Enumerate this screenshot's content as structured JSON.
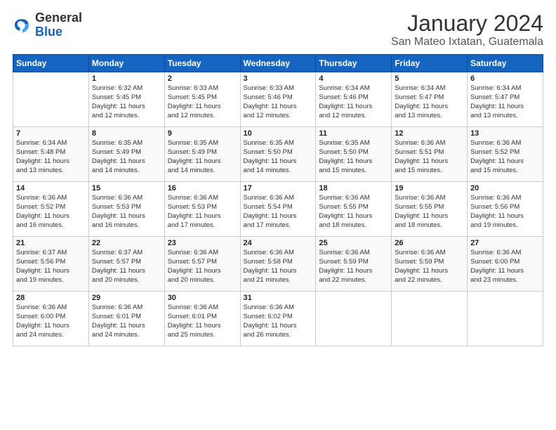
{
  "logo": {
    "general": "General",
    "blue": "Blue"
  },
  "title": "January 2024",
  "subtitle": "San Mateo Ixtatan, Guatemala",
  "days_of_week": [
    "Sunday",
    "Monday",
    "Tuesday",
    "Wednesday",
    "Thursday",
    "Friday",
    "Saturday"
  ],
  "weeks": [
    [
      {
        "day": "",
        "sunrise": "",
        "sunset": "",
        "daylight": "",
        "extra": ""
      },
      {
        "day": "1",
        "sunrise": "Sunrise: 6:32 AM",
        "sunset": "Sunset: 5:45 PM",
        "daylight": "Daylight: 11 hours",
        "extra": "and 12 minutes."
      },
      {
        "day": "2",
        "sunrise": "Sunrise: 6:33 AM",
        "sunset": "Sunset: 5:45 PM",
        "daylight": "Daylight: 11 hours",
        "extra": "and 12 minutes."
      },
      {
        "day": "3",
        "sunrise": "Sunrise: 6:33 AM",
        "sunset": "Sunset: 5:46 PM",
        "daylight": "Daylight: 11 hours",
        "extra": "and 12 minutes."
      },
      {
        "day": "4",
        "sunrise": "Sunrise: 6:34 AM",
        "sunset": "Sunset: 5:46 PM",
        "daylight": "Daylight: 11 hours",
        "extra": "and 12 minutes."
      },
      {
        "day": "5",
        "sunrise": "Sunrise: 6:34 AM",
        "sunset": "Sunset: 5:47 PM",
        "daylight": "Daylight: 11 hours",
        "extra": "and 13 minutes."
      },
      {
        "day": "6",
        "sunrise": "Sunrise: 6:34 AM",
        "sunset": "Sunset: 5:47 PM",
        "daylight": "Daylight: 11 hours",
        "extra": "and 13 minutes."
      }
    ],
    [
      {
        "day": "7",
        "sunrise": "Sunrise: 6:34 AM",
        "sunset": "Sunset: 5:48 PM",
        "daylight": "Daylight: 11 hours",
        "extra": "and 13 minutes."
      },
      {
        "day": "8",
        "sunrise": "Sunrise: 6:35 AM",
        "sunset": "Sunset: 5:49 PM",
        "daylight": "Daylight: 11 hours",
        "extra": "and 14 minutes."
      },
      {
        "day": "9",
        "sunrise": "Sunrise: 6:35 AM",
        "sunset": "Sunset: 5:49 PM",
        "daylight": "Daylight: 11 hours",
        "extra": "and 14 minutes."
      },
      {
        "day": "10",
        "sunrise": "Sunrise: 6:35 AM",
        "sunset": "Sunset: 5:50 PM",
        "daylight": "Daylight: 11 hours",
        "extra": "and 14 minutes."
      },
      {
        "day": "11",
        "sunrise": "Sunrise: 6:35 AM",
        "sunset": "Sunset: 5:50 PM",
        "daylight": "Daylight: 11 hours",
        "extra": "and 15 minutes."
      },
      {
        "day": "12",
        "sunrise": "Sunrise: 6:36 AM",
        "sunset": "Sunset: 5:51 PM",
        "daylight": "Daylight: 11 hours",
        "extra": "and 15 minutes."
      },
      {
        "day": "13",
        "sunrise": "Sunrise: 6:36 AM",
        "sunset": "Sunset: 5:52 PM",
        "daylight": "Daylight: 11 hours",
        "extra": "and 15 minutes."
      }
    ],
    [
      {
        "day": "14",
        "sunrise": "Sunrise: 6:36 AM",
        "sunset": "Sunset: 5:52 PM",
        "daylight": "Daylight: 11 hours",
        "extra": "and 16 minutes."
      },
      {
        "day": "15",
        "sunrise": "Sunrise: 6:36 AM",
        "sunset": "Sunset: 5:53 PM",
        "daylight": "Daylight: 11 hours",
        "extra": "and 16 minutes."
      },
      {
        "day": "16",
        "sunrise": "Sunrise: 6:36 AM",
        "sunset": "Sunset: 5:53 PM",
        "daylight": "Daylight: 11 hours",
        "extra": "and 17 minutes."
      },
      {
        "day": "17",
        "sunrise": "Sunrise: 6:36 AM",
        "sunset": "Sunset: 5:54 PM",
        "daylight": "Daylight: 11 hours",
        "extra": "and 17 minutes."
      },
      {
        "day": "18",
        "sunrise": "Sunrise: 6:36 AM",
        "sunset": "Sunset: 5:55 PM",
        "daylight": "Daylight: 11 hours",
        "extra": "and 18 minutes."
      },
      {
        "day": "19",
        "sunrise": "Sunrise: 6:36 AM",
        "sunset": "Sunset: 5:55 PM",
        "daylight": "Daylight: 11 hours",
        "extra": "and 18 minutes."
      },
      {
        "day": "20",
        "sunrise": "Sunrise: 6:36 AM",
        "sunset": "Sunset: 5:56 PM",
        "daylight": "Daylight: 11 hours",
        "extra": "and 19 minutes."
      }
    ],
    [
      {
        "day": "21",
        "sunrise": "Sunrise: 6:37 AM",
        "sunset": "Sunset: 5:56 PM",
        "daylight": "Daylight: 11 hours",
        "extra": "and 19 minutes."
      },
      {
        "day": "22",
        "sunrise": "Sunrise: 6:37 AM",
        "sunset": "Sunset: 5:57 PM",
        "daylight": "Daylight: 11 hours",
        "extra": "and 20 minutes."
      },
      {
        "day": "23",
        "sunrise": "Sunrise: 6:36 AM",
        "sunset": "Sunset: 5:57 PM",
        "daylight": "Daylight: 11 hours",
        "extra": "and 20 minutes."
      },
      {
        "day": "24",
        "sunrise": "Sunrise: 6:36 AM",
        "sunset": "Sunset: 5:58 PM",
        "daylight": "Daylight: 11 hours",
        "extra": "and 21 minutes."
      },
      {
        "day": "25",
        "sunrise": "Sunrise: 6:36 AM",
        "sunset": "Sunset: 5:59 PM",
        "daylight": "Daylight: 11 hours",
        "extra": "and 22 minutes."
      },
      {
        "day": "26",
        "sunrise": "Sunrise: 6:36 AM",
        "sunset": "Sunset: 5:59 PM",
        "daylight": "Daylight: 11 hours",
        "extra": "and 22 minutes."
      },
      {
        "day": "27",
        "sunrise": "Sunrise: 6:36 AM",
        "sunset": "Sunset: 6:00 PM",
        "daylight": "Daylight: 11 hours",
        "extra": "and 23 minutes."
      }
    ],
    [
      {
        "day": "28",
        "sunrise": "Sunrise: 6:36 AM",
        "sunset": "Sunset: 6:00 PM",
        "daylight": "Daylight: 11 hours",
        "extra": "and 24 minutes."
      },
      {
        "day": "29",
        "sunrise": "Sunrise: 6:36 AM",
        "sunset": "Sunset: 6:01 PM",
        "daylight": "Daylight: 11 hours",
        "extra": "and 24 minutes."
      },
      {
        "day": "30",
        "sunrise": "Sunrise: 6:36 AM",
        "sunset": "Sunset: 6:01 PM",
        "daylight": "Daylight: 11 hours",
        "extra": "and 25 minutes."
      },
      {
        "day": "31",
        "sunrise": "Sunrise: 6:36 AM",
        "sunset": "Sunset: 6:02 PM",
        "daylight": "Daylight: 11 hours",
        "extra": "and 26 minutes."
      },
      {
        "day": "",
        "sunrise": "",
        "sunset": "",
        "daylight": "",
        "extra": ""
      },
      {
        "day": "",
        "sunrise": "",
        "sunset": "",
        "daylight": "",
        "extra": ""
      },
      {
        "day": "",
        "sunrise": "",
        "sunset": "",
        "daylight": "",
        "extra": ""
      }
    ]
  ]
}
